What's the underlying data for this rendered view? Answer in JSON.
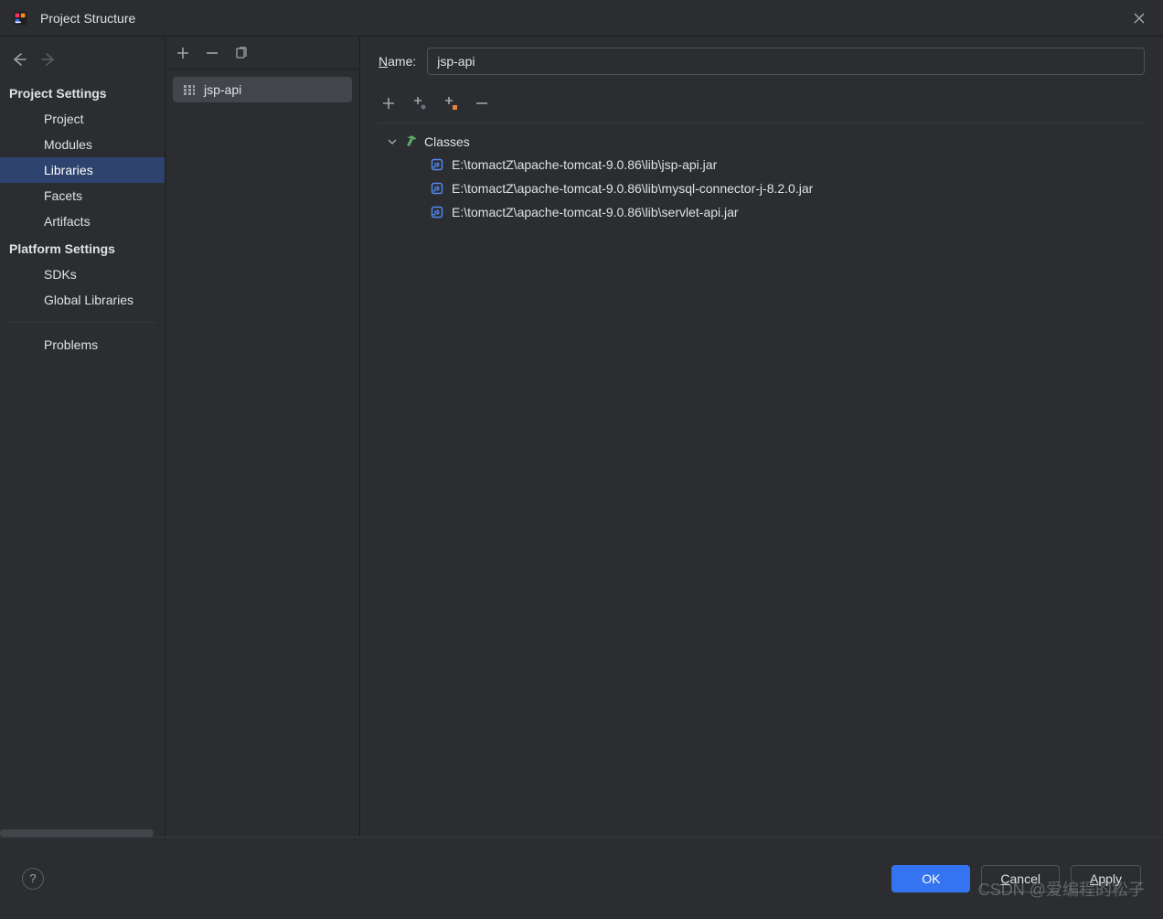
{
  "titlebar": {
    "title": "Project Structure"
  },
  "sidebar": {
    "sections": [
      {
        "header": "Project Settings",
        "items": [
          {
            "label": "Project"
          },
          {
            "label": "Modules"
          },
          {
            "label": "Libraries",
            "selected": true
          },
          {
            "label": "Facets"
          },
          {
            "label": "Artifacts"
          }
        ]
      },
      {
        "header": "Platform Settings",
        "items": [
          {
            "label": "SDKs"
          },
          {
            "label": "Global Libraries"
          }
        ]
      }
    ],
    "bottom": [
      {
        "label": "Problems"
      }
    ]
  },
  "middle": {
    "selected": {
      "label": "jsp-api"
    }
  },
  "content": {
    "name_label_n": "N",
    "name_label_rest": "ame:",
    "name_value": "jsp-api",
    "tree_root": "Classes",
    "jars": [
      "E:\\tomactZ\\apache-tomcat-9.0.86\\lib\\jsp-api.jar",
      "E:\\tomactZ\\apache-tomcat-9.0.86\\lib\\mysql-connector-j-8.2.0.jar",
      "E:\\tomactZ\\apache-tomcat-9.0.86\\lib\\servlet-api.jar"
    ]
  },
  "footer": {
    "ok": "OK",
    "cancel_c": "C",
    "cancel_rest": "ancel",
    "apply_a": "A",
    "apply_rest": "pply"
  },
  "watermark": "CSDN @爱编程的松子"
}
